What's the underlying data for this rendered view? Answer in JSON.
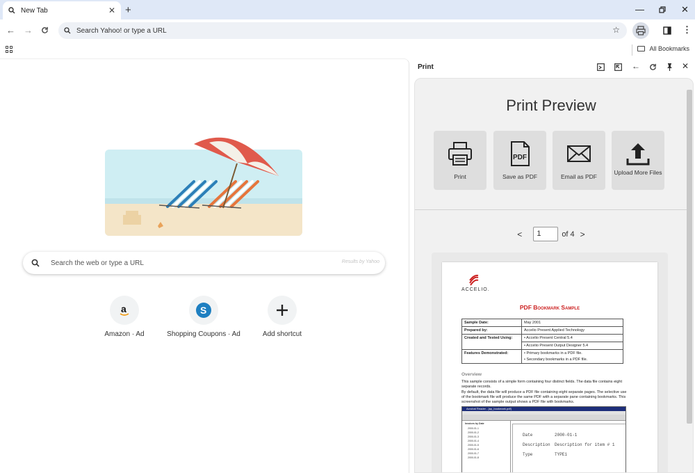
{
  "browser": {
    "tab_title": "New Tab",
    "new_tab_symbol": "+",
    "omnibox_placeholder": "Search Yahoo! or type a URL",
    "all_bookmarks_label": "All Bookmarks"
  },
  "newtab_page": {
    "search_placeholder": "Search the web or type a URL",
    "results_by": "Results by Yahoo",
    "shortcuts": [
      {
        "label": "Amazon · Ad",
        "icon": "amazon-icon"
      },
      {
        "label": "Shopping Coupons · Ad",
        "icon": "coupons-icon"
      },
      {
        "label": "Add shortcut",
        "icon": "plus-icon"
      }
    ]
  },
  "side_panel": {
    "title": "Print",
    "preview_heading": "Print Preview",
    "actions": [
      {
        "label": "Print",
        "icon": "printer-icon"
      },
      {
        "label": "Save as PDF",
        "icon": "pdf-icon"
      },
      {
        "label": "Email as PDF",
        "icon": "email-icon"
      },
      {
        "label": "Upload More Files",
        "icon": "upload-icon"
      }
    ],
    "pager": {
      "prev": "<",
      "current_page": "1",
      "of_label": "of 4",
      "next": ">"
    }
  },
  "document": {
    "logo_text": "ACCELIO.",
    "title": "PDF Bookmark Sample",
    "table": [
      {
        "key": "Sample Date:",
        "value": [
          "May 2001"
        ]
      },
      {
        "key": "Prepared by:",
        "value": [
          "Accelio Present Applied Technology"
        ]
      },
      {
        "key": "Created and Tested Using:",
        "value": [
          "•   Accelio Present Central 5.4",
          "•   Accelio Present Output Designer 5.4"
        ]
      },
      {
        "key": "Features Demonstrated:",
        "value": [
          "•   Primary bookmarks in a PDF file.",
          "•   Secondary bookmarks in a PDF file."
        ]
      }
    ],
    "overview_heading": "Overview",
    "para1": "This sample consists of a simple form containing four distinct fields. The data file contains eight separate records.",
    "para2": "By default, the data file will produce a PDF file containing eight separate pages. The selective use of the bookmark file will produce the same PDF with a separate pane containing bookmarks. This screenshot of the sample output shows a PDF file with bookmarks.",
    "screenshot": {
      "window_title": "Acrobat Reader - [ap_bookmark.pdf]",
      "tree_root": "Invoices by Date",
      "tree_items": [
        "2000-01-1",
        "2000-01-2",
        "2000-01-3",
        "2000-01-4",
        "2000-01-5",
        "2000-01-6",
        "2000-01-7",
        "2000-01-8"
      ],
      "rows": [
        {
          "k": "Date",
          "v": "2000-01-1"
        },
        {
          "k": "Description",
          "v": "Description for item # 1"
        },
        {
          "k": "Type",
          "v": "TYPE1"
        }
      ]
    }
  },
  "colors": {
    "tabstrip": "#dfe8f7",
    "doc_title_red": "#cc2222",
    "panel_bg": "#f1f1f1",
    "action_button": "#dedede"
  }
}
